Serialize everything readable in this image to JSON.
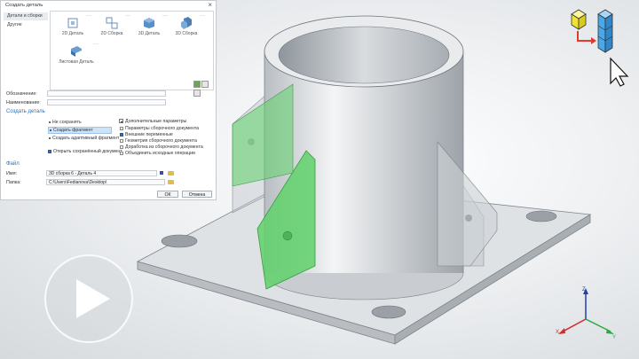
{
  "dialog": {
    "title": "Создать деталь",
    "close_glyph": "×",
    "tabs": [
      "Детали и сборки",
      "Другие"
    ],
    "tiles": [
      {
        "label": "2D Деталь",
        "icon": "part-2d-icon"
      },
      {
        "label": "2D Сборка",
        "icon": "assembly-2d-icon"
      },
      {
        "label": "3D Деталь",
        "icon": "part-3d-icon"
      },
      {
        "label": "3D Сборка",
        "icon": "assembly-3d-icon"
      },
      {
        "label": "Листовая Деталь",
        "icon": "sheet-metal-icon"
      }
    ],
    "tile_more": "···",
    "fields": {
      "designation_label": "Обозначение:",
      "designation_value": "",
      "name_label": "Наименование:",
      "name_value": ""
    },
    "create_section": "Создать деталь",
    "radio_options": [
      "Не сохранять",
      "Создать фрагмент",
      "Создать адаптивный фрагмент"
    ],
    "selected_option": 1,
    "open_saved_label": "Открыть сохранённый документ",
    "extra_params_label": "Дополнительные параметры",
    "extra_params": [
      {
        "label": "Параметры сборочного документа",
        "checked": false
      },
      {
        "label": "Внешние переменные",
        "checked": true
      },
      {
        "label": "Геометрия сборочного документа",
        "checked": false
      },
      {
        "label": "Доработка из сборочного документа",
        "checked": false
      },
      {
        "label": "Объединить исходные операции",
        "checked": false
      }
    ],
    "file_section": "Файл",
    "file_name_label": "Имя:",
    "file_name_value": "3D сборка 6 - Деталь 4",
    "folder_label": "Папка:",
    "folder_value": "C:\\Users\\Fedianova\\Desktop\\",
    "ok_label": "ОК",
    "cancel_label": "Отмена"
  },
  "colors": {
    "accent": "#2f6fb5",
    "green_part": "#5fd16a",
    "cube_yellow": "#f4e842",
    "cube_blue": "#4aa8e8",
    "arrow_red": "#e23b2e"
  },
  "triad": {
    "z": "Z",
    "x": "X",
    "y": "Y"
  },
  "overlay": {
    "play_icon": "play-icon"
  }
}
